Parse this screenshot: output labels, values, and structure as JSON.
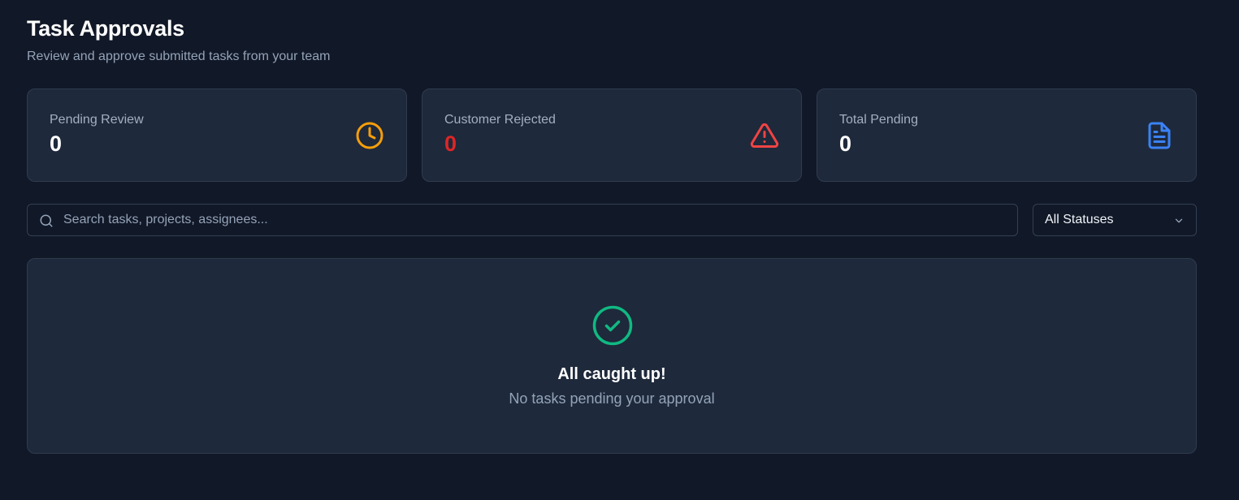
{
  "header": {
    "title": "Task Approvals",
    "subtitle": "Review and approve submitted tasks from your team"
  },
  "stats": [
    {
      "label": "Pending Review",
      "value": "0",
      "icon": "clock-icon",
      "color": "#f59e0b"
    },
    {
      "label": "Customer Rejected",
      "value": "0",
      "icon": "warning-icon",
      "color": "#dc2626"
    },
    {
      "label": "Total Pending",
      "value": "0",
      "icon": "document-icon",
      "color": "#3b82f6"
    }
  ],
  "search": {
    "placeholder": "Search tasks, projects, assignees...",
    "value": ""
  },
  "filter": {
    "selected": "All Statuses"
  },
  "empty_state": {
    "title": "All caught up!",
    "subtitle": "No tasks pending your approval",
    "icon": "check-circle-icon",
    "color": "#10b981"
  }
}
